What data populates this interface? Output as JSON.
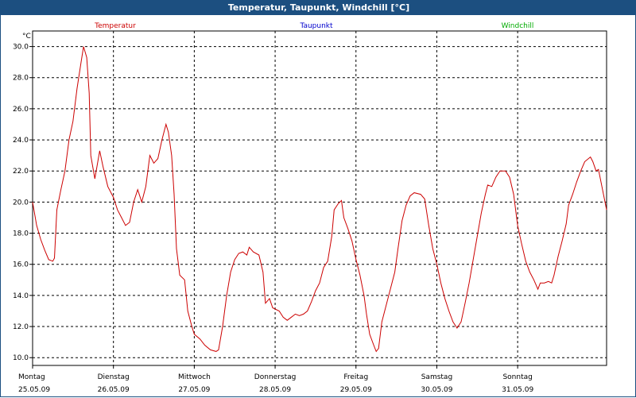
{
  "window": {
    "title": "Temperatur, Taupunkt, Windchill [°C]"
  },
  "chart_data": {
    "type": "line",
    "yunit": "°C",
    "ylim": [
      9.5,
      31.0
    ],
    "yticks": [
      "10.0",
      "12.0",
      "14.0",
      "16.0",
      "18.0",
      "20.0",
      "22.0",
      "24.0",
      "26.0",
      "28.0",
      "30.0"
    ],
    "ytick_values": [
      10,
      12,
      14,
      16,
      18,
      20,
      22,
      24,
      26,
      28,
      30
    ],
    "xlim": [
      0,
      7.1
    ],
    "xticks": [
      {
        "day": "Montag",
        "date": "25.05.09",
        "value": 0
      },
      {
        "day": "Dienstag",
        "date": "26.05.09",
        "value": 1
      },
      {
        "day": "Mittwoch",
        "date": "27.05.09",
        "value": 2
      },
      {
        "day": "Donnerstag",
        "date": "28.05.09",
        "value": 3
      },
      {
        "day": "Freitag",
        "date": "29.05.09",
        "value": 4
      },
      {
        "day": "Samstag",
        "date": "30.05.09",
        "value": 5
      },
      {
        "day": "Sonntag",
        "date": "31.05.09",
        "value": 6
      }
    ],
    "grid": true,
    "legend_placement": "top",
    "series": [
      {
        "name": "Temperatur",
        "color": "#cc0000",
        "points": [
          [
            0.0,
            20.0
          ],
          [
            0.05,
            18.5
          ],
          [
            0.1,
            17.6
          ],
          [
            0.15,
            16.9
          ],
          [
            0.2,
            16.3
          ],
          [
            0.25,
            16.2
          ],
          [
            0.27,
            16.4
          ],
          [
            0.3,
            19.5
          ],
          [
            0.35,
            20.8
          ],
          [
            0.4,
            22.0
          ],
          [
            0.45,
            24.0
          ],
          [
            0.5,
            25.2
          ],
          [
            0.55,
            27.3
          ],
          [
            0.6,
            29.0
          ],
          [
            0.63,
            30.0
          ],
          [
            0.67,
            29.3
          ],
          [
            0.7,
            27.0
          ],
          [
            0.72,
            23.0
          ],
          [
            0.77,
            21.5
          ],
          [
            0.83,
            23.3
          ],
          [
            0.87,
            22.3
          ],
          [
            0.93,
            21.0
          ],
          [
            1.0,
            20.3
          ],
          [
            1.05,
            19.5
          ],
          [
            1.1,
            19.0
          ],
          [
            1.15,
            18.5
          ],
          [
            1.2,
            18.7
          ],
          [
            1.25,
            20.0
          ],
          [
            1.3,
            20.8
          ],
          [
            1.35,
            20.0
          ],
          [
            1.4,
            21.0
          ],
          [
            1.45,
            23.0
          ],
          [
            1.5,
            22.5
          ],
          [
            1.55,
            22.8
          ],
          [
            1.6,
            24.0
          ],
          [
            1.65,
            25.0
          ],
          [
            1.68,
            24.5
          ],
          [
            1.72,
            23.0
          ],
          [
            1.75,
            20.5
          ],
          [
            1.78,
            17.0
          ],
          [
            1.82,
            15.3
          ],
          [
            1.88,
            15.0
          ],
          [
            1.92,
            13.0
          ],
          [
            1.97,
            12.0
          ],
          [
            2.0,
            11.5
          ],
          [
            2.07,
            11.2
          ],
          [
            2.13,
            10.8
          ],
          [
            2.2,
            10.5
          ],
          [
            2.27,
            10.4
          ],
          [
            2.3,
            10.5
          ],
          [
            2.35,
            12.0
          ],
          [
            2.4,
            14.0
          ],
          [
            2.45,
            15.5
          ],
          [
            2.5,
            16.3
          ],
          [
            2.55,
            16.7
          ],
          [
            2.6,
            16.8
          ],
          [
            2.65,
            16.6
          ],
          [
            2.68,
            17.1
          ],
          [
            2.73,
            16.8
          ],
          [
            2.8,
            16.6
          ],
          [
            2.85,
            15.5
          ],
          [
            2.88,
            13.5
          ],
          [
            2.93,
            13.8
          ],
          [
            2.97,
            13.2
          ],
          [
            3.05,
            13.0
          ],
          [
            3.1,
            12.6
          ],
          [
            3.15,
            12.4
          ],
          [
            3.2,
            12.6
          ],
          [
            3.25,
            12.8
          ],
          [
            3.3,
            12.7
          ],
          [
            3.35,
            12.8
          ],
          [
            3.4,
            13.0
          ],
          [
            3.45,
            13.6
          ],
          [
            3.5,
            14.3
          ],
          [
            3.55,
            14.8
          ],
          [
            3.6,
            15.8
          ],
          [
            3.65,
            16.2
          ],
          [
            3.7,
            17.8
          ],
          [
            3.73,
            19.5
          ],
          [
            3.78,
            19.9
          ],
          [
            3.82,
            20.1
          ],
          [
            3.85,
            19.0
          ],
          [
            3.9,
            18.3
          ],
          [
            3.95,
            17.5
          ],
          [
            4.0,
            16.3
          ],
          [
            4.05,
            15.3
          ],
          [
            4.1,
            14.0
          ],
          [
            4.13,
            12.8
          ],
          [
            4.17,
            11.5
          ],
          [
            4.22,
            10.8
          ],
          [
            4.25,
            10.4
          ],
          [
            4.28,
            10.6
          ],
          [
            4.32,
            12.3
          ],
          [
            4.37,
            13.3
          ],
          [
            4.42,
            14.3
          ],
          [
            4.48,
            15.5
          ],
          [
            4.52,
            17.0
          ],
          [
            4.57,
            18.8
          ],
          [
            4.62,
            19.8
          ],
          [
            4.67,
            20.4
          ],
          [
            4.72,
            20.6
          ],
          [
            4.8,
            20.5
          ],
          [
            4.85,
            20.2
          ],
          [
            4.9,
            18.5
          ],
          [
            4.95,
            17.0
          ],
          [
            5.0,
            16.0
          ],
          [
            5.05,
            14.8
          ],
          [
            5.1,
            13.8
          ],
          [
            5.15,
            13.0
          ],
          [
            5.2,
            12.3
          ],
          [
            5.25,
            11.9
          ],
          [
            5.3,
            12.3
          ],
          [
            5.35,
            13.5
          ],
          [
            5.4,
            14.8
          ],
          [
            5.45,
            16.3
          ],
          [
            5.5,
            17.8
          ],
          [
            5.55,
            19.3
          ],
          [
            5.6,
            20.5
          ],
          [
            5.63,
            21.1
          ],
          [
            5.68,
            21.0
          ],
          [
            5.73,
            21.6
          ],
          [
            5.78,
            22.0
          ],
          [
            5.85,
            22.0
          ],
          [
            5.9,
            21.6
          ],
          [
            5.95,
            20.5
          ],
          [
            6.0,
            18.5
          ],
          [
            6.05,
            17.3
          ],
          [
            6.1,
            16.2
          ],
          [
            6.15,
            15.5
          ],
          [
            6.2,
            15.0
          ],
          [
            6.25,
            14.4
          ],
          [
            6.28,
            14.8
          ],
          [
            6.33,
            14.8
          ],
          [
            6.38,
            14.9
          ],
          [
            6.42,
            14.8
          ],
          [
            6.45,
            15.3
          ],
          [
            6.5,
            16.5
          ],
          [
            6.55,
            17.5
          ],
          [
            6.6,
            18.6
          ],
          [
            6.63,
            19.8
          ],
          [
            6.68,
            20.5
          ],
          [
            6.73,
            21.3
          ],
          [
            6.78,
            22.0
          ],
          [
            6.83,
            22.6
          ],
          [
            6.9,
            22.9
          ],
          [
            6.93,
            22.6
          ],
          [
            6.97,
            22.0
          ],
          [
            7.0,
            22.1
          ],
          [
            7.05,
            20.8
          ],
          [
            7.1,
            19.5
          ]
        ]
      }
    ],
    "legend": [
      {
        "name": "Temperatur",
        "color": "#cc0000"
      },
      {
        "name": "Taupunkt",
        "color": "#0000cc"
      },
      {
        "name": "Windchill",
        "color": "#00aa00"
      }
    ]
  }
}
